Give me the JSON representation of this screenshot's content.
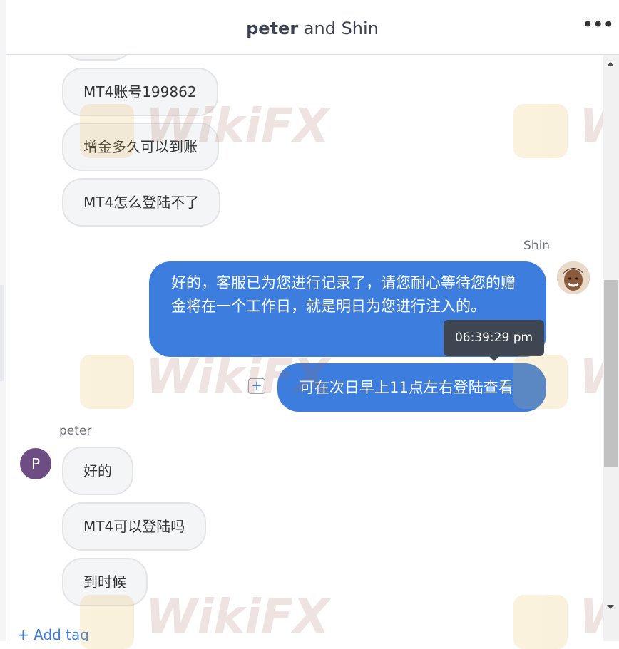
{
  "header": {
    "title_part1": "peter",
    "title_part2": " and Shin",
    "more_icon": "•••"
  },
  "messages_incoming_top": [
    {
      "text": "MT4账号199862"
    },
    {
      "text": "增金多久可以到账"
    },
    {
      "text": "MT4怎么登陆不了"
    }
  ],
  "shin": {
    "name": "Shin",
    "messages": [
      {
        "text": "好的，客服已为您进行记录了，请您耐心等待您的赠金将在一个工作日，就是明日为您进行注入的。"
      },
      {
        "text": "可在次日早上11点左右登陆查看"
      }
    ],
    "tooltip_time": "06:39:29 pm"
  },
  "peter": {
    "name": "peter",
    "avatar_letter": "P",
    "messages": [
      {
        "text": "好的"
      },
      {
        "text": "MT4可以登陆吗"
      },
      {
        "text": "到时候"
      }
    ]
  },
  "plus_label": "+",
  "add_tag_label": "+ Add tag",
  "watermark_text": "WikiFX",
  "colors": {
    "outgoing_bubble": "#3c7ddd",
    "incoming_bubble": "#f4f5f6",
    "avatar_peter": "#6e4c84",
    "link": "#3c7ddd"
  }
}
